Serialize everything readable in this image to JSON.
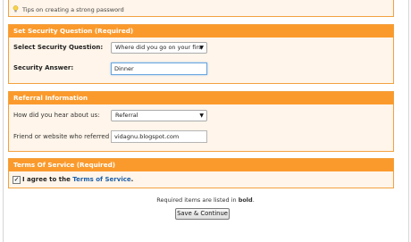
{
  "tip": {
    "text": "Tips on creating a strong password",
    "icon": "lightbulb-icon"
  },
  "security": {
    "header": "Set Security Question (Required)",
    "question_label": "Select Security Question:",
    "question_value": "Where did you go on your firs",
    "answer_label": "Security Answer:",
    "answer_value": "Dinner"
  },
  "referral": {
    "header": "Referral Information",
    "source_label": "How did you hear about us:",
    "source_value": "Referral",
    "friend_label": "Friend or website who referred you:",
    "friend_value": "vidagnu.blogspot.com"
  },
  "terms": {
    "header": "Terms Of Service (Required)",
    "agree_prefix": "I agree to the",
    "link_text": "Terms of Service",
    "agree_suffix": ".",
    "checked": true
  },
  "footer": {
    "note_prefix": "Required items are listed in",
    "note_bold": "bold",
    "note_suffix": ".",
    "button_label": "Save & Continue"
  },
  "colors": {
    "header": "#fb9a2c",
    "panel_bg": "#fff5ea",
    "border": "#f3a141",
    "link": "#1c5fa8"
  }
}
